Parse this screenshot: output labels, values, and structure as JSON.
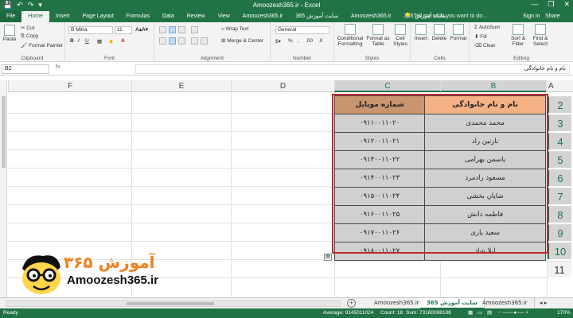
{
  "window": {
    "title": "Amoozesh365.ir - Excel",
    "min": "—",
    "restore": "❐",
    "close": "✕"
  },
  "tabs": [
    {
      "label": "File"
    },
    {
      "label": "Home"
    },
    {
      "label": "Insert"
    },
    {
      "label": "Page Layout"
    },
    {
      "label": "Formulas"
    },
    {
      "label": "Data"
    },
    {
      "label": "Review"
    },
    {
      "label": "View"
    },
    {
      "label": "Amoozesh365.ir"
    },
    {
      "label": "سایت آموزش 365"
    },
    {
      "label": "Amoozesh365.ir"
    },
    {
      "label": "سایت آموزش 365"
    }
  ],
  "tellme": "Tell me what you want to do...",
  "signin": "Sign in",
  "share": "Share",
  "ribbon": {
    "clipboard": {
      "label": "Clipboard",
      "paste": "Paste",
      "cut": "Cut",
      "copy": "Copy",
      "format_painter": "Format Painter"
    },
    "font": {
      "label": "Font",
      "name": "B Mitra",
      "size": "11"
    },
    "alignment": {
      "label": "Alignment",
      "wrap": "Wrap Text",
      "merge": "Merge & Center"
    },
    "number": {
      "label": "Number",
      "format": "General"
    },
    "styles": {
      "label": "Styles",
      "cond": "Conditional Formatting",
      "table": "Format as Table",
      "cell": "Cell Styles"
    },
    "cells": {
      "label": "Cells",
      "insert": "Insert",
      "delete": "Delete",
      "format": "Format"
    },
    "editing": {
      "label": "Editing",
      "autosum": "AutoSum",
      "fill": "Fill",
      "clear": "Clear",
      "sort": "Sort & Filter",
      "find": "Find & Select"
    }
  },
  "formula_bar": {
    "name_box": "B2",
    "fx": "fx",
    "content": "نام و نام خانوادگی"
  },
  "columns": [
    "F",
    "E",
    "D",
    "C",
    "B",
    "A"
  ],
  "rows": [
    "2",
    "3",
    "4",
    "5",
    "6",
    "7",
    "8",
    "9",
    "10",
    "11"
  ],
  "table": {
    "headers": {
      "b": "نام و نام خانوادگی",
      "c": "شماره موبایل"
    },
    "rows": [
      {
        "name": "محمد محمدی",
        "mobile": "۰۹۱۱۰۰۱۱۰۲۰"
      },
      {
        "name": "نازنین راد",
        "mobile": "۰۹۱۲۰۰۱۱۰۲۱"
      },
      {
        "name": "یاسمن بهرامی",
        "mobile": "۰۹۱۳۰۰۱۱۰۲۲"
      },
      {
        "name": "مسعود رادمرد",
        "mobile": "۰۹۱۴۰۰۱۱۰۲۳"
      },
      {
        "name": "شایان بخشی",
        "mobile": "۰۹۱۵۰۰۱۱۰۲۴"
      },
      {
        "name": "فاطمه دانش",
        "mobile": "۰۹۱۶۰۰۱۱۰۲۵"
      },
      {
        "name": "سعید یاری",
        "mobile": "۰۹۱۷۰۰۱۱۰۲۶"
      },
      {
        "name": "لیلا شاد",
        "mobile": "۰۹۱۸۰۰۱۱۰۲۷"
      }
    ]
  },
  "logo": {
    "fa": "آموزش ۳۶۵",
    "en": "Amoozesh365.ir"
  },
  "sheets": [
    {
      "label": "Amoozesh365.ir"
    },
    {
      "label": "سایت آموزش 365"
    },
    {
      "label": "Amoozesh365.ir"
    }
  ],
  "add_sheet": "+",
  "status": {
    "ready": "Ready",
    "average": "Average: 9145011024",
    "count": "Count: 18",
    "sum": "Sum: 73160088188",
    "zoom": "170%"
  },
  "colors": {
    "accent": "#217346",
    "header_b": "#f4b183",
    "header_c": "#c9956f",
    "selection": "#c0282b",
    "logo_orange": "#f0821e"
  }
}
